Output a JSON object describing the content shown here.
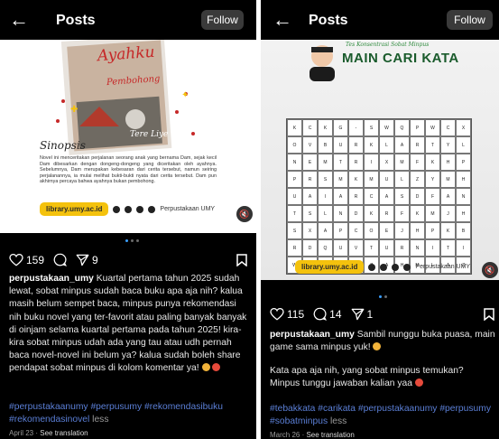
{
  "left": {
    "header": {
      "title": "Posts",
      "follow_label": "Follow"
    },
    "cover": {
      "title_line1": "Ayahku",
      "title_line2": "Pembohong",
      "author": "Tere Liye",
      "sinopsis_heading": "Sinopsis",
      "sinopsis_text": "Novel ini menceritakan perjalanan seorang anak yang bernama Dam, sejak kecil Dam dibesarkan dengan dongeng-dongeng yang diceritakan oleh ayahnya. Sebelumnya, Dam merupakan kebesaran dari cerita tersebut, namun seiring perjalanannya, ia mulai melihat bukti-bukti nyata dari cerita tersebut. Dam pun akhirnya percaya bahwa ayahnya bukan pembohong.",
      "link": "library.umy.ac.id",
      "social_text": "Perpustakaan UMY",
      "mute": "🔇"
    },
    "likes": "159",
    "shares": "9",
    "caption_user": "perpustakaan_umy",
    "caption_text": "Kuartal pertama tahun 2025 sudah lewat, sobat minpus sudah baca buku apa aja nih? kalua masih belum sempet baca, minpus punya rekomendasi nih buku novel yang ter-favorit atau paling banyak banyak di oinjam selama kuartal pertama pada tahun 2025! kira-kira sobat minpus udah ada yang tau atau udh pernah baca novel-novel ini belum ya? kalua sudah boleh share pendapat sobat minpus di kolom komentar ya!",
    "hashtags": "#perpustakaanumy #perpusumy #rekomendasibuku #rekomendasinovel",
    "less": "less",
    "date": "April 23",
    "see_translation": "See translation"
  },
  "right": {
    "header": {
      "title": "Posts",
      "follow_label": "Follow"
    },
    "game": {
      "subtitle": "Tes Konsentrasi Sobat Minpus",
      "title": "MAIN CARI KATA",
      "grid": [
        [
          "K",
          "C",
          "K",
          "G",
          "-",
          "S",
          "W",
          "Q",
          "P",
          "W",
          "C",
          "X"
        ],
        [
          "O",
          "V",
          "B",
          "U",
          "R",
          "K",
          "L",
          "A",
          "R",
          "T",
          "Y",
          "L"
        ],
        [
          "N",
          "E",
          "M",
          "T",
          "R",
          "I",
          "X",
          "M",
          "F",
          "K",
          "H",
          "P"
        ],
        [
          "P",
          "R",
          "S",
          "M",
          "K",
          "M",
          "U",
          "L",
          "Z",
          "Y",
          "M",
          "H"
        ],
        [
          "U",
          "A",
          "I",
          "A",
          "R",
          "C",
          "A",
          "S",
          "D",
          "F",
          "A",
          "N"
        ],
        [
          "T",
          "S",
          "L",
          "N",
          "D",
          "K",
          "R",
          "F",
          "K",
          "M",
          "J",
          "H"
        ],
        [
          "S",
          "X",
          "A",
          "P",
          "C",
          "O",
          "E",
          "J",
          "H",
          "P",
          "K",
          "B"
        ],
        [
          "R",
          "D",
          "Q",
          "U",
          "V",
          "T",
          "U",
          "R",
          "N",
          "I",
          "T",
          "I"
        ],
        [
          "W",
          "E",
          "Y",
          "R",
          "M",
          "Z",
          "A",
          "H",
          "M",
          "L",
          "A",
          "Z"
        ]
      ],
      "link": "library.umy.ac.id",
      "social_text": "Perpustakaan UMY",
      "mute": "🔇"
    },
    "likes": "115",
    "comments": "14",
    "shares": "1",
    "caption_user": "perpustakaan_umy",
    "caption_text": "Sambil nunggu buka puasa, main game sama minpus yuk!",
    "caption_text2": "Kata apa aja nih, yang sobat minpus temukan? Minpus tunggu jawaban kalian yaa",
    "hashtags": "#tebakkata #carikata #perpustakaanumy #perpusumy #sobatminpus",
    "less": "less",
    "date": "March 26",
    "see_translation": "See translation"
  },
  "left_comments": "",
  "colors": {
    "accent_yellow": "#f4c20d",
    "link_blue": "#5b7fd6",
    "active_dot": "#3aa0ff"
  }
}
